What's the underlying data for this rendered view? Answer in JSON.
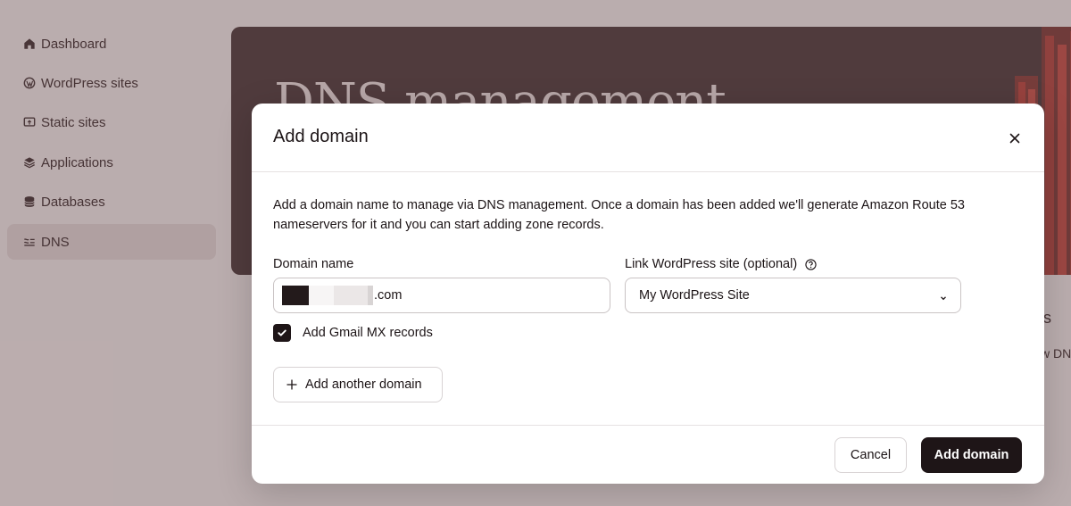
{
  "sidebar": {
    "items": [
      {
        "label": "Dashboard",
        "icon": "home-icon"
      },
      {
        "label": "WordPress sites",
        "icon": "wordpress-icon"
      },
      {
        "label": "Static sites",
        "icon": "static-sites-icon"
      },
      {
        "label": "Applications",
        "icon": "applications-icon"
      },
      {
        "label": "Databases",
        "icon": "database-icon"
      },
      {
        "label": "DNS",
        "icon": "dns-icon",
        "active": true
      }
    ]
  },
  "page": {
    "hero_title": "DNS management",
    "partial_texts": [
      "ks",
      "w DN"
    ]
  },
  "modal": {
    "title": "Add domain",
    "description": "Add a domain name to manage via DNS management. Once a domain has been added we'll generate Amazon Route 53 nameservers for it and you can start adding zone records.",
    "domain_label": "Domain name",
    "domain_value_suffix": ".com",
    "link_label": "Link WordPress site (optional)",
    "link_selected": "My WordPress Site",
    "gmail_label": "Add Gmail MX records",
    "gmail_checked": true,
    "add_another_label": "Add another domain",
    "cancel_label": "Cancel",
    "submit_label": "Add domain"
  },
  "colors": {
    "primary": "#1e1517",
    "hero_bg": "#4a3b3c",
    "accent_red": "#c0463f"
  }
}
